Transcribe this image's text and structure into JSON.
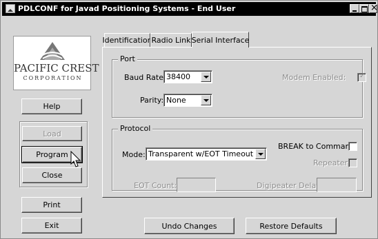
{
  "window": {
    "title": "PDLCONF for Javad Positioning Systems - End User"
  },
  "logo": {
    "name": "PACIFIC CREST",
    "subtitle": "CORPORATION"
  },
  "sidebar": {
    "help": "Help",
    "load": "Load",
    "program": "Program",
    "close": "Close",
    "print": "Print",
    "exit": "Exit"
  },
  "tabs": [
    {
      "label": "Identification"
    },
    {
      "label": "Radio Link"
    },
    {
      "label": "Serial Interface"
    }
  ],
  "port": {
    "title": "Port",
    "baud_label": "Baud Rate:",
    "baud_value": "38400",
    "parity_label": "Parity:",
    "parity_value": "None",
    "modem_label": "Modem Enabled:"
  },
  "protocol": {
    "title": "Protocol",
    "mode_label": "Mode:",
    "mode_value": "Transparent w/EOT Timeout",
    "break_label": "BREAK to Command:",
    "repeater_label": "Repeater:",
    "eot_label": "EOT Count:",
    "digi_label": "Digipeater Delay:"
  },
  "footer": {
    "undo": "Undo Changes",
    "restore": "Restore Defaults"
  },
  "icons": {
    "app": "app-icon",
    "minimize": "minimize-icon",
    "maximize": "maximize-icon",
    "close": "close-icon",
    "checkmark": "checkmark-icon",
    "cursor": "mouse-pointer-icon"
  }
}
